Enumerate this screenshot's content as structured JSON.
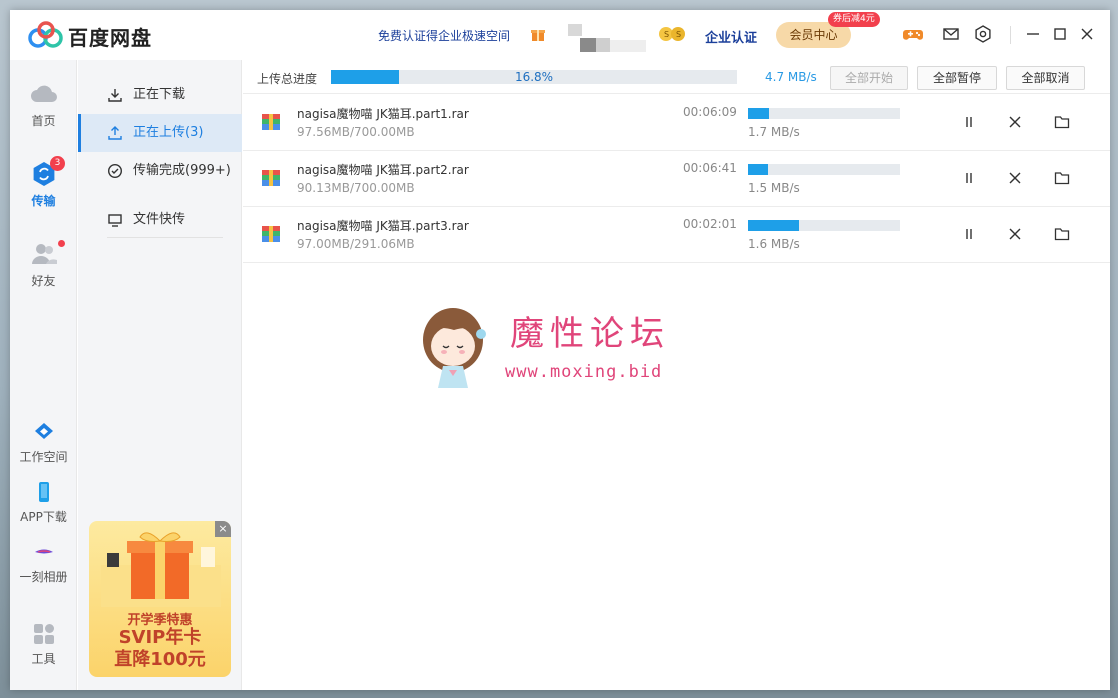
{
  "app": {
    "title": "百度网盘",
    "promo_link": "免费认证得企业极速空间",
    "enterprise_link": "企业认证",
    "vip_label": "会员中心",
    "vip_badge": "券后减4元"
  },
  "leftnav": {
    "items": [
      {
        "label": "首页",
        "icon": "cloud-icon"
      },
      {
        "label": "传输",
        "icon": "transfer-icon",
        "badge": "3",
        "active": true
      },
      {
        "label": "好友",
        "icon": "friends-icon"
      },
      {
        "label": "工作空间",
        "icon": "workspace-icon"
      },
      {
        "label": "APP下载",
        "icon": "phone-icon"
      },
      {
        "label": "一刻相册",
        "icon": "album-icon"
      },
      {
        "label": "工具",
        "icon": "tools-icon"
      }
    ]
  },
  "subnav": {
    "items": [
      {
        "label": "正在下载",
        "icon": "download-icon"
      },
      {
        "label": "正在上传(3)",
        "icon": "upload-icon",
        "active": true
      },
      {
        "label": "传输完成(999+)",
        "icon": "check-circle-icon"
      },
      {
        "label": "文件快传",
        "icon": "monitor-icon"
      }
    ],
    "ad": {
      "sub": "开学季特惠",
      "line1": "SVIP年卡",
      "line2": "直降100元",
      "close": "×"
    }
  },
  "upload": {
    "total_label": "上传总进度",
    "total_percent_text": "16.8%",
    "total_progress": 0.168,
    "total_speed": "4.7 MB/s",
    "btn_start_all": "全部开始",
    "btn_pause_all": "全部暂停",
    "btn_cancel_all": "全部取消",
    "tasks": [
      {
        "name": "nagisa魔物喵 JK猫耳.part1.rar",
        "size": "97.56MB/700.00MB",
        "time": "00:06:09",
        "speed": "1.7 MB/s",
        "progress": 0.139
      },
      {
        "name": "nagisa魔物喵 JK猫耳.part2.rar",
        "size": "90.13MB/700.00MB",
        "time": "00:06:41",
        "speed": "1.5 MB/s",
        "progress": 0.129
      },
      {
        "name": "nagisa魔物喵 JK猫耳.part3.rar",
        "size": "97.00MB/291.06MB",
        "time": "00:02:01",
        "speed": "1.6 MB/s",
        "progress": 0.333
      }
    ]
  },
  "watermark": {
    "title": "魔性论坛",
    "url": "www.moxing.bid"
  },
  "colors": {
    "accent": "#1e9fe8",
    "brand": "#1e7fe0",
    "badge": "#f2404d"
  }
}
